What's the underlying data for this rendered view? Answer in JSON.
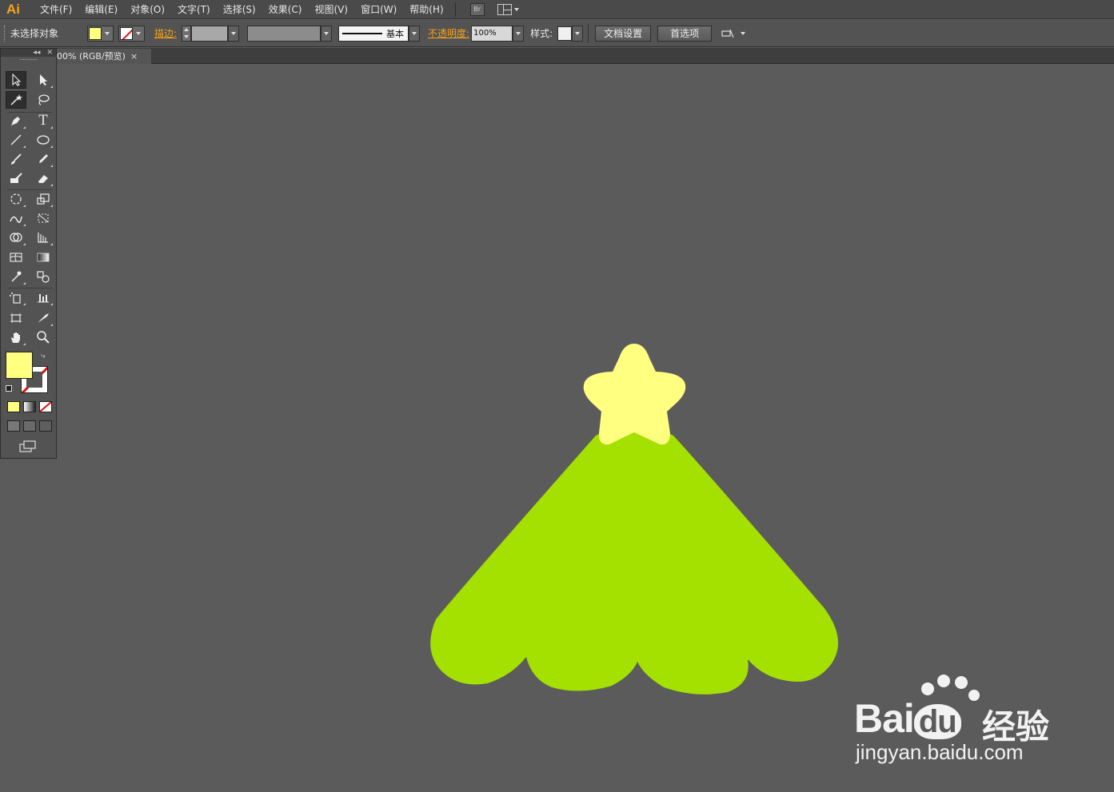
{
  "app": {
    "logo": "Ai",
    "accent": "#f7a21c"
  },
  "menu": {
    "items": [
      "文件(F)",
      "编辑(E)",
      "对象(O)",
      "文字(T)",
      "选择(S)",
      "效果(C)",
      "视图(V)",
      "窗口(W)",
      "帮助(H)"
    ],
    "bridge_label": "Br"
  },
  "control": {
    "selection_status": "未选择对象",
    "stroke_label": "描边:",
    "stroke_profile_label": "基本",
    "opacity_label": "不透明度:",
    "opacity_value": "100%",
    "style_label": "样式:",
    "doc_setup_button": "文档设置",
    "preferences_button": "首选项"
  },
  "document": {
    "tab_title": "00% (RGB/预览)",
    "close_symbol": "×"
  },
  "colors": {
    "fill": "#ffff80",
    "tree_green": "#a4e000",
    "star_yellow": "#ffff80",
    "canvas": "#5b5b5b"
  },
  "tools": [
    [
      "selection-tool",
      "direct-selection-tool"
    ],
    [
      "magic-wand-tool",
      "lasso-tool"
    ],
    [
      "pen-tool",
      "type-tool"
    ],
    [
      "line-segment-tool",
      "ellipse-tool"
    ],
    [
      "paintbrush-tool",
      "pencil-tool"
    ],
    [
      "blob-brush-tool",
      "eraser-tool"
    ],
    [
      "rotate-tool",
      "scale-tool"
    ],
    [
      "warp-tool",
      "free-transform-tool"
    ],
    [
      "shape-builder-tool",
      "perspective-grid-tool"
    ],
    [
      "mesh-tool",
      "gradient-tool"
    ],
    [
      "eyedropper-tool",
      "blend-tool"
    ],
    [
      "symbol-sprayer-tool",
      "column-graph-tool"
    ],
    [
      "artboard-tool",
      "slice-tool"
    ],
    [
      "hand-tool",
      "zoom-tool"
    ]
  ],
  "watermark": {
    "brand": "Bai",
    "brand2": "du",
    "cn": "经验",
    "url": "jingyan.baidu.com"
  }
}
